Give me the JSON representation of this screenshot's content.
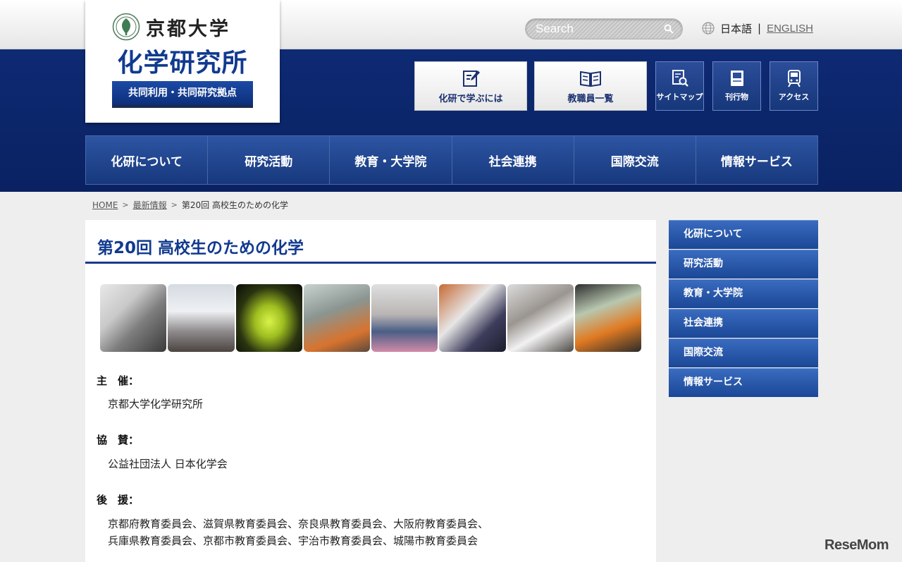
{
  "logo": {
    "university": "京都大学",
    "institute": "化学研究所",
    "tagline": "共同利用・共同研究拠点"
  },
  "search": {
    "placeholder": "Search"
  },
  "lang": {
    "japanese": "日本語",
    "separator": "|",
    "english": "ENGLISH"
  },
  "header_buttons": [
    {
      "label": "化研で学ぶには",
      "icon": "pencil-note-icon"
    },
    {
      "label": "教職員一覧",
      "icon": "open-book-icon"
    },
    {
      "label": "サイトマップ",
      "icon": "sitemap-search-icon"
    },
    {
      "label": "刊行物",
      "icon": "publication-icon"
    },
    {
      "label": "アクセス",
      "icon": "train-icon"
    }
  ],
  "global_nav": [
    "化研について",
    "研究活動",
    "教育・大学院",
    "社会連携",
    "国際交流",
    "情報サービス"
  ],
  "breadcrumb": {
    "home": "HOME",
    "news": "最新情報",
    "current": "第20回 高校生のための化学",
    "sep": ">"
  },
  "page": {
    "title": "第20回 高校生のための化学",
    "sections": [
      {
        "label": "主　催：",
        "lines": [
          "京都大学化学研究所"
        ]
      },
      {
        "label": "協　賛：",
        "lines": [
          "公益社団法人 日本化学会"
        ]
      },
      {
        "label": "後　援：",
        "lines": [
          "京都府教育委員会、滋賀県教育委員会、奈良県教育委員会、大阪府教育委員会、",
          "兵庫県教育委員会、京都市教育委員会、宇治市教育委員会、城陽市教育委員会"
        ]
      }
    ]
  },
  "side_nav": [
    "化研について",
    "研究活動",
    "教育・大学院",
    "社会連携",
    "国際交流",
    "情報サービス"
  ],
  "watermark": "ReseMom",
  "colors": {
    "navy": "#0e2a73",
    "title_blue": "#113a8f",
    "nav_blue": "#2d55a3"
  }
}
